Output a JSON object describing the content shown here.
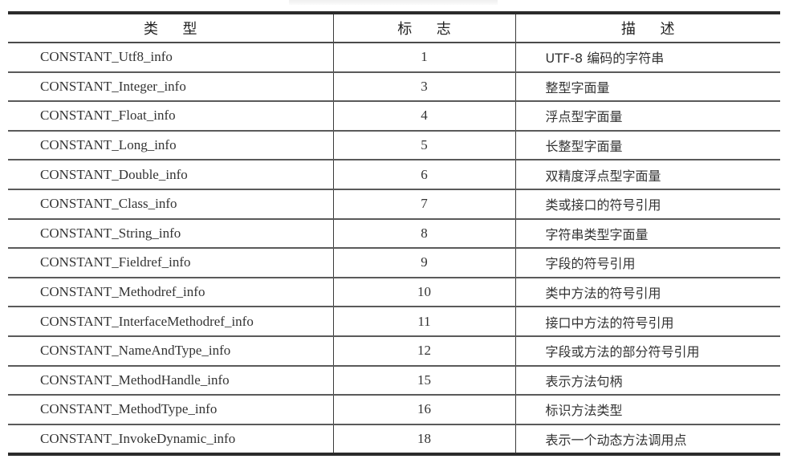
{
  "table": {
    "headers": {
      "type": "类 型",
      "tag": "标 志",
      "description": "描 述"
    },
    "rows": [
      {
        "type": "CONSTANT_Utf8_info",
        "tag": "1",
        "description": "UTF-8 编码的字符串"
      },
      {
        "type": "CONSTANT_Integer_info",
        "tag": "3",
        "description": "整型字面量"
      },
      {
        "type": "CONSTANT_Float_info",
        "tag": "4",
        "description": "浮点型字面量"
      },
      {
        "type": "CONSTANT_Long_info",
        "tag": "5",
        "description": "长整型字面量"
      },
      {
        "type": "CONSTANT_Double_info",
        "tag": "6",
        "description": "双精度浮点型字面量"
      },
      {
        "type": "CONSTANT_Class_info",
        "tag": "7",
        "description": "类或接口的符号引用"
      },
      {
        "type": "CONSTANT_String_info",
        "tag": "8",
        "description": "字符串类型字面量"
      },
      {
        "type": "CONSTANT_Fieldref_info",
        "tag": "9",
        "description": "字段的符号引用"
      },
      {
        "type": "CONSTANT_Methodref_info",
        "tag": "10",
        "description": "类中方法的符号引用"
      },
      {
        "type": "CONSTANT_InterfaceMethodref_info",
        "tag": "11",
        "description": "接口中方法的符号引用"
      },
      {
        "type": "CONSTANT_NameAndType_info",
        "tag": "12",
        "description": "字段或方法的部分符号引用"
      },
      {
        "type": "CONSTANT_MethodHandle_info",
        "tag": "15",
        "description": "表示方法句柄"
      },
      {
        "type": "CONSTANT_MethodType_info",
        "tag": "16",
        "description": "标识方法类型"
      },
      {
        "type": "CONSTANT_InvokeDynamic_info",
        "tag": "18",
        "description": "表示一个动态方法调用点"
      }
    ]
  }
}
